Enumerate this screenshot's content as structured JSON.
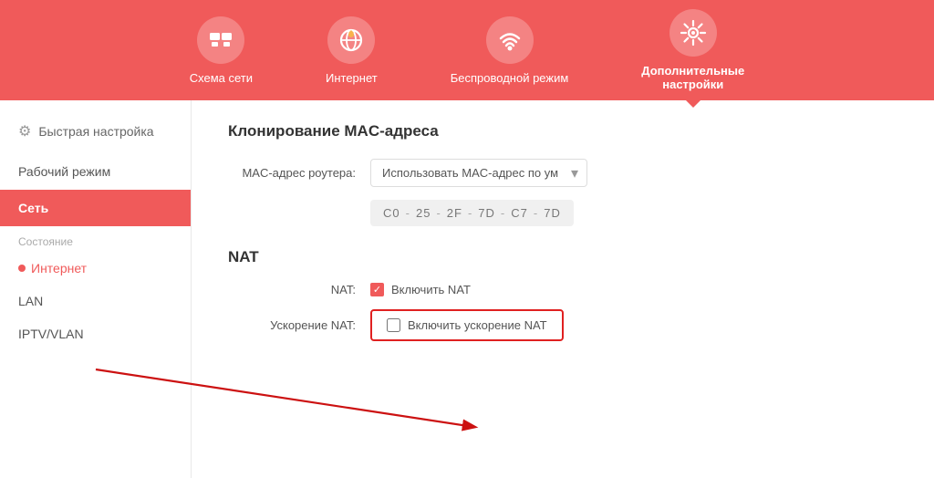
{
  "topNav": {
    "items": [
      {
        "id": "schema",
        "label": "Схема сети",
        "icon": "🖥️",
        "active": false
      },
      {
        "id": "internet",
        "label": "Интернет",
        "icon": "🌐",
        "active": false
      },
      {
        "id": "wireless",
        "label": "Беспроводной\nрежим",
        "icon": "📶",
        "active": false
      },
      {
        "id": "advanced",
        "label": "Дополнительные\nнастройки",
        "icon": "⚙️",
        "active": true
      }
    ]
  },
  "sidebar": {
    "quick_setup": "Быстрая настройка",
    "work_mode": "Рабочий режим",
    "network": "Сеть",
    "state_label": "Состояние",
    "internet_item": "Интернет",
    "lan_item": "LAN",
    "iptv_item": "IPTV/VLAN"
  },
  "content": {
    "mac_clone_title": "Клонирование MAC-адреса",
    "mac_router_label": "MAC-адрес роутера:",
    "mac_select_value": "Использовать MAC-адрес по ум",
    "mac_address": [
      "C0",
      "25",
      "2F",
      "7D",
      "C7",
      "7D"
    ],
    "nat_title": "NAT",
    "nat_label": "NAT:",
    "nat_enable_label": "Включить NAT",
    "nat_accel_label": "Ускорение NAT:",
    "nat_accel_enable_label": "Включить ускорение NAT"
  },
  "colors": {
    "primary": "#f05a5a",
    "sidebar_active_bg": "#f05a5a",
    "arrow_color": "#cc0000"
  }
}
